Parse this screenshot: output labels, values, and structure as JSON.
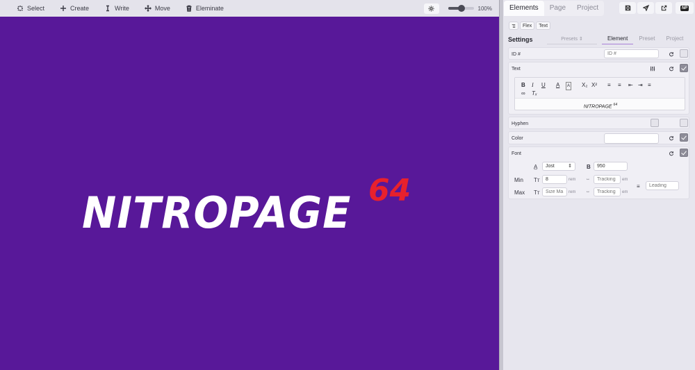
{
  "toolbar": {
    "tools": [
      {
        "label": "Select",
        "icon": "select-icon"
      },
      {
        "label": "Create",
        "icon": "plus-icon"
      },
      {
        "label": "Write",
        "icon": "text-cursor-icon"
      },
      {
        "label": "Move",
        "icon": "move-icon"
      },
      {
        "label": "Eleminate",
        "icon": "trash-icon"
      }
    ],
    "zoom": {
      "label": "100%",
      "value": 1.0
    }
  },
  "canvas": {
    "background": "#581899",
    "brand_text": "NITROPAGE",
    "brand_sup": "64",
    "brand_color": "#ffffff",
    "sup_color": "#e8212c"
  },
  "panel": {
    "tabs": [
      "Elements",
      "Page",
      "Project"
    ],
    "active_tab": "Elements",
    "np_badge": "NP",
    "chips": [
      "Flex",
      "Text"
    ],
    "settings": {
      "title": "Settings",
      "presets_label": "Presets",
      "subtabs": [
        "Element",
        "Preset",
        "Project"
      ],
      "active_subtab": "Element"
    },
    "id": {
      "label": "ID #",
      "placeholder": "ID #"
    },
    "text": {
      "label": "Text",
      "toolbar": {
        "bold": "B",
        "italic": "I",
        "underline": "U",
        "subscript": "X₂",
        "superscript": "X²"
      },
      "content": "NITROPAGE",
      "content_sup": "64"
    },
    "hyphen": {
      "label": "Hyphen"
    },
    "color": {
      "label": "Color"
    },
    "font": {
      "label": "Font",
      "family": "Jost",
      "weight": "950",
      "min_label": "Min",
      "max_label": "Max",
      "min_size": "8",
      "max_size_placeholder": "Size Ma",
      "tracking_placeholder": "Tracking",
      "leading_placeholder": "Leading",
      "unit_rem": "rem",
      "unit_em": "em"
    }
  }
}
